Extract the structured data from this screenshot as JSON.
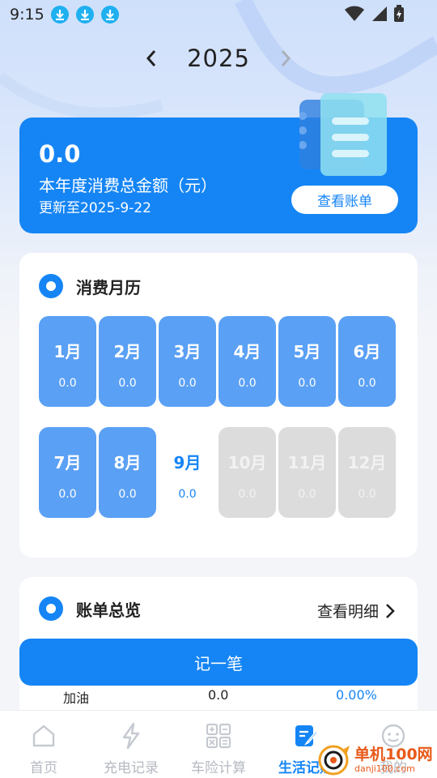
{
  "status_bar": {
    "time": "9:15",
    "icons": [
      "download-icon",
      "download-icon",
      "download-icon",
      "wifi-icon",
      "signal-icon",
      "battery-icon"
    ]
  },
  "year_selector": {
    "year": "2025",
    "prev_icon": "chevron-left-icon",
    "next_icon": "chevron-right-icon"
  },
  "summary": {
    "amount": "0.0",
    "label": "本年度消费总金额（元）",
    "updated": "更新至2025-9-22",
    "view_bill_label": "查看账单"
  },
  "calendar": {
    "title": "消费月历",
    "months": [
      {
        "name": "1月",
        "value": "0.0",
        "state": "past"
      },
      {
        "name": "2月",
        "value": "0.0",
        "state": "past"
      },
      {
        "name": "3月",
        "value": "0.0",
        "state": "past"
      },
      {
        "name": "4月",
        "value": "0.0",
        "state": "past"
      },
      {
        "name": "5月",
        "value": "0.0",
        "state": "past"
      },
      {
        "name": "6月",
        "value": "0.0",
        "state": "past"
      },
      {
        "name": "7月",
        "value": "0.0",
        "state": "past"
      },
      {
        "name": "8月",
        "value": "0.0",
        "state": "past"
      },
      {
        "name": "9月",
        "value": "0.0",
        "state": "current"
      },
      {
        "name": "10月",
        "value": "0.0",
        "state": "future"
      },
      {
        "name": "11月",
        "value": "0.0",
        "state": "future"
      },
      {
        "name": "12月",
        "value": "0.0",
        "state": "future"
      }
    ]
  },
  "bill_overview": {
    "title": "账单总览",
    "detail_label": "查看明细",
    "rows": [
      {
        "name": "加油",
        "amount": "0.0",
        "percent": "0.00%"
      }
    ]
  },
  "record_button": "记一笔",
  "nav": [
    {
      "label": "首页",
      "icon": "home-icon",
      "active": false
    },
    {
      "label": "充电记录",
      "icon": "lightning-icon",
      "active": false
    },
    {
      "label": "车险计算",
      "icon": "calculator-icon",
      "active": false
    },
    {
      "label": "生活记账",
      "icon": "notebook-pen-icon",
      "active": true
    },
    {
      "label": "我的",
      "icon": "smiley-icon",
      "active": false
    }
  ],
  "watermark": {
    "text": "单机100网",
    "sub": "danji100.com"
  },
  "colors": {
    "accent": "#1585f5",
    "month_past": "#5aa0f5",
    "month_future": "#dcdcdc",
    "inactive_nav": "#b5b9c1"
  }
}
